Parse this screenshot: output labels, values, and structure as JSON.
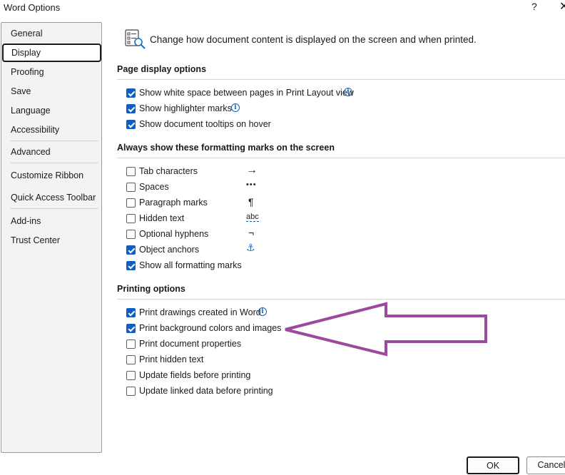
{
  "window": {
    "title": "Word Options",
    "help": "?",
    "close": "✕"
  },
  "sidebar": {
    "items": [
      {
        "label": "General"
      },
      {
        "label": "Display"
      },
      {
        "label": "Proofing"
      },
      {
        "label": "Save"
      },
      {
        "label": "Language"
      },
      {
        "label": "Accessibility"
      },
      {
        "label": "Advanced"
      },
      {
        "label": "Customize Ribbon"
      },
      {
        "label": "Quick Access Toolbar"
      },
      {
        "label": "Add-ins"
      },
      {
        "label": "Trust Center"
      }
    ],
    "selected": "Display"
  },
  "header": {
    "text": "Change how document content is displayed on the screen and when printed.",
    "icon": "display-settings-icon"
  },
  "sections": [
    {
      "title": "Page display options",
      "options": [
        {
          "label": "Show white space between pages in Print Layout view",
          "checked": true,
          "info": true
        },
        {
          "label": "Show highlighter marks",
          "checked": true,
          "info": true
        },
        {
          "label": "Show document tooltips on hover",
          "checked": true
        }
      ]
    },
    {
      "title": "Always show these formatting marks on the screen",
      "options": [
        {
          "label": "Tab characters",
          "checked": false,
          "mark": "→"
        },
        {
          "label": "Spaces",
          "checked": false,
          "mark": "•••"
        },
        {
          "label": "Paragraph marks",
          "checked": false,
          "mark": "¶"
        },
        {
          "label": "Hidden text",
          "checked": false,
          "mark": "abc"
        },
        {
          "label": "Optional hyphens",
          "checked": false,
          "mark": "¬"
        },
        {
          "label": "Object anchors",
          "checked": true,
          "mark": "⚓"
        },
        {
          "label": "Show all formatting marks",
          "checked": true
        }
      ]
    },
    {
      "title": "Printing options",
      "options": [
        {
          "label": "Print drawings created in Word",
          "checked": true,
          "info": true
        },
        {
          "label": "Print background colors and images",
          "checked": true
        },
        {
          "label": "Print document properties",
          "checked": false
        },
        {
          "label": "Print hidden text",
          "checked": false
        },
        {
          "label": "Update fields before printing",
          "checked": false
        },
        {
          "label": "Update linked data before printing",
          "checked": false
        }
      ]
    }
  ],
  "buttons": {
    "ok": "OK",
    "cancel": "Cancel"
  },
  "annotation": {
    "arrow_color": "#9b4a9e"
  }
}
